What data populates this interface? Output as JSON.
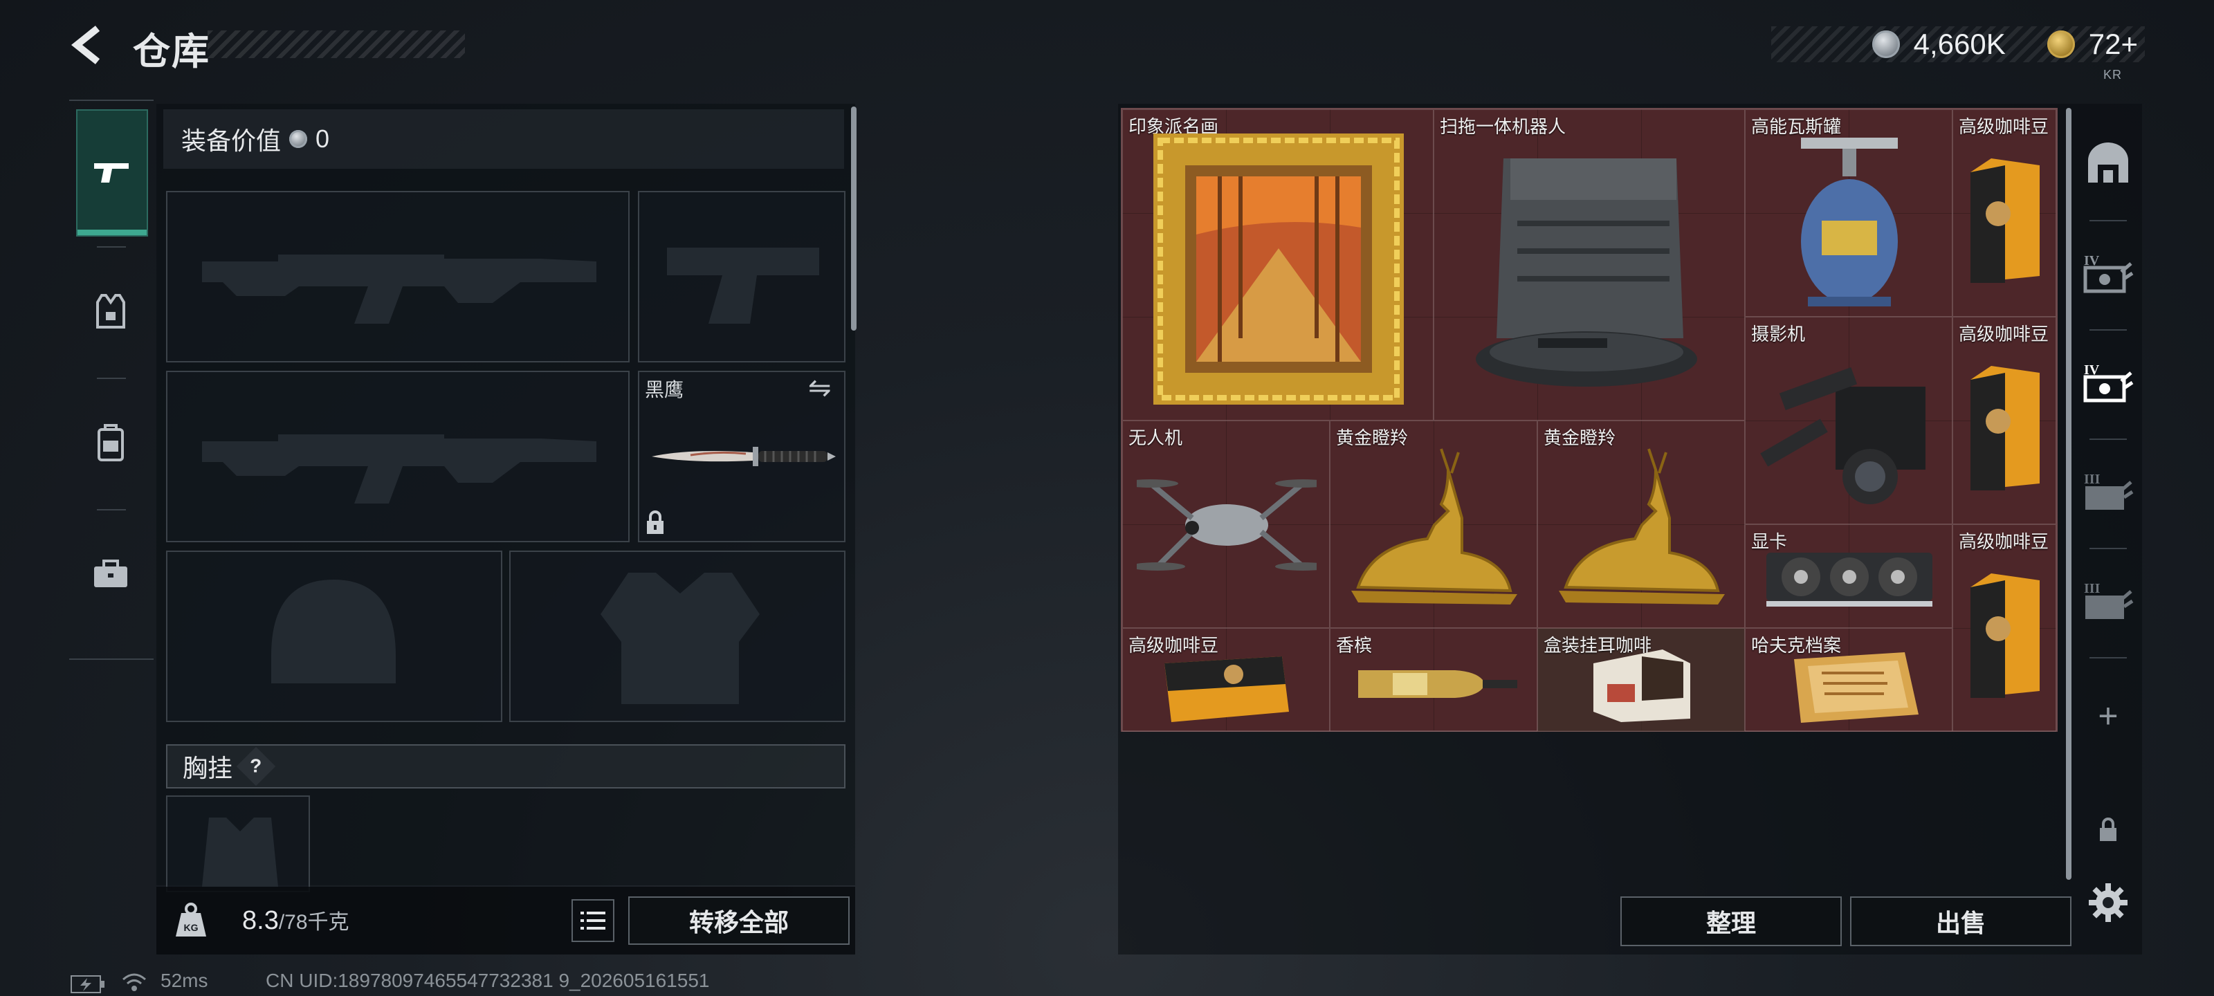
{
  "header": {
    "title": "仓库",
    "currency": [
      {
        "icon": "silver-coin-icon",
        "value": "4,660K"
      },
      {
        "icon": "gold-coin-icon",
        "value": "72+"
      }
    ],
    "badge": "KR"
  },
  "left_rail": {
    "items": [
      {
        "name": "weapon-tab",
        "icon": "pistol-icon",
        "active": true
      },
      {
        "name": "armor-tab",
        "icon": "vest-icon",
        "active": false
      },
      {
        "name": "backpack-tab",
        "icon": "backpack-icon",
        "active": false
      },
      {
        "name": "toolbox-tab",
        "icon": "briefcase-icon",
        "active": false
      }
    ]
  },
  "equipment": {
    "value_label": "装备价值",
    "value": "0",
    "knife_slot_label": "黑鹰",
    "chest_rig_label": "胸挂",
    "help": "?",
    "weight": "8.3",
    "weight_max": "/78千克",
    "transfer_all": "转移全部"
  },
  "stash": {
    "items": [
      {
        "id": "painting",
        "name": "印象派名画",
        "icon": "framed-painting-icon"
      },
      {
        "id": "robot",
        "name": "扫拖一体机器人",
        "icon": "robot-vacuum-icon"
      },
      {
        "id": "gas",
        "name": "高能瓦斯罐",
        "icon": "gas-canister-icon"
      },
      {
        "id": "coffee1",
        "name": "高级咖啡豆",
        "icon": "coffee-bag-icon"
      },
      {
        "id": "camera",
        "name": "摄影机",
        "icon": "video-camera-icon"
      },
      {
        "id": "coffee2",
        "name": "高级咖啡豆",
        "icon": "coffee-bag-icon"
      },
      {
        "id": "drone",
        "name": "无人机",
        "icon": "drone-icon"
      },
      {
        "id": "deer1",
        "name": "黄金瞪羚",
        "icon": "golden-deer-icon"
      },
      {
        "id": "deer2",
        "name": "黄金瞪羚",
        "icon": "golden-deer-icon"
      },
      {
        "id": "gpu",
        "name": "显卡",
        "icon": "graphics-card-icon"
      },
      {
        "id": "coffee3",
        "name": "高级咖啡豆",
        "icon": "coffee-bag-icon"
      },
      {
        "id": "coffee4",
        "name": "高级咖啡豆",
        "icon": "coffee-bag-icon"
      },
      {
        "id": "champagne",
        "name": "香槟",
        "icon": "champagne-bottle-icon"
      },
      {
        "id": "boxcoffee",
        "name": "盒装挂耳咖啡",
        "icon": "coffee-box-icon"
      },
      {
        "id": "files",
        "name": "哈夫克档案",
        "icon": "documents-icon"
      }
    ],
    "sort_button": "整理",
    "sell_button": "出售"
  },
  "right_rail": {
    "tabs": [
      {
        "icon": "stash-home-icon"
      },
      {
        "icon": "tier4-case-icon",
        "label": "IV"
      },
      {
        "icon": "tier4-case-icon",
        "label": "IV"
      },
      {
        "icon": "tier3-case-icon",
        "label": "III"
      },
      {
        "icon": "tier3-case-icon",
        "label": "III"
      }
    ],
    "add": "+",
    "settings_icon": "gear-icon"
  },
  "status_bar": {
    "ping": "52ms",
    "uid": "CN UID:18978097465547732381 9_202605161551"
  },
  "colors": {
    "stash_bg": "#4d2629",
    "active_tab": "#163d37",
    "accent": "#3ea890"
  }
}
